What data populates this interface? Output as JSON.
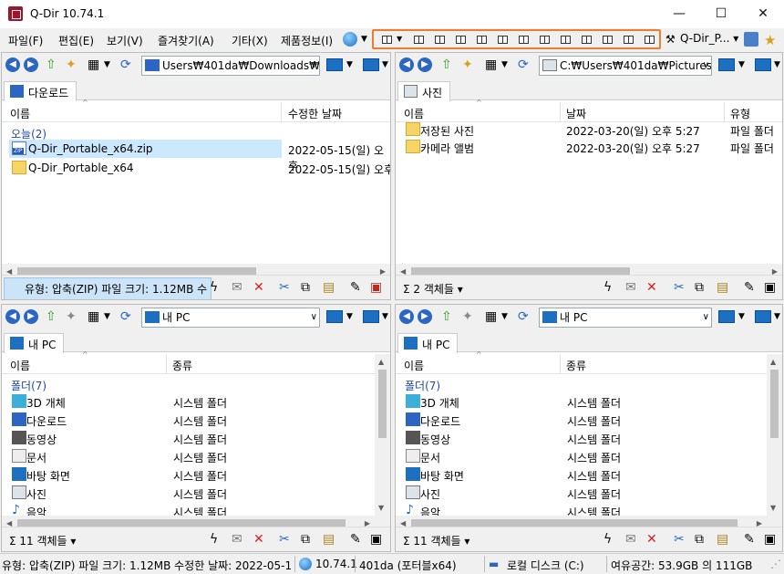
{
  "window": {
    "title": "Q-Dir 10.74.1",
    "min": "—",
    "max": "☐",
    "close": "✕"
  },
  "menu": [
    "파일(F)",
    "편집(E)",
    "보기(V)",
    "즐겨찾기(A)",
    "기타(X)",
    "제품정보(I)"
  ],
  "layout_strip_icons": [
    "layout-4-pane-icon",
    "layout-icon",
    "layout-icon",
    "layout-icon",
    "layout-icon",
    "layout-icon",
    "layout-icon",
    "layout-icon",
    "layout-icon",
    "layout-icon",
    "layout-icon",
    "layout-icon",
    "layout-icon"
  ],
  "qdir_combo": "Q-Dir_P...",
  "panes": {
    "top_left": {
      "address": "Users₩401da₩Downloads₩",
      "tab": "다운로드",
      "columns": [
        "이름",
        "수정한 날짜"
      ],
      "group": "오늘(2)",
      "rows": [
        {
          "name": "Q-Dir_Portable_x64.zip",
          "date": "2022-05-15(일) 오후",
          "icon": "zip-icon",
          "selected": true
        },
        {
          "name": "Q-Dir_Portable_x64",
          "date": "2022-05-15(일) 오후",
          "icon": "folder-icon",
          "selected": false
        }
      ],
      "status": "유형: 압축(ZIP) 파일 크기: 1.12MB 수"
    },
    "top_right": {
      "address": "C:₩Users₩401da₩Pictures₩",
      "tab": "사진",
      "columns": [
        "이름",
        "날짜",
        "유형"
      ],
      "rows": [
        {
          "name": "저장된 사진",
          "date": "2022-03-20(일) 오후 5:27",
          "type": "파일 폴더"
        },
        {
          "name": "카메라 앨범",
          "date": "2022-03-20(일) 오후 5:27",
          "type": "파일 폴더"
        }
      ],
      "status": "Σ  2 객체들 ▾"
    },
    "bottom_left": {
      "address": "내 PC",
      "tab": "내 PC",
      "columns": [
        "이름",
        "종류"
      ],
      "group": "폴더(7)",
      "rows": [
        {
          "name": "3D 개체",
          "type": "시스템 폴더",
          "icon": "cube-3d-icon"
        },
        {
          "name": "다운로드",
          "type": "시스템 폴더",
          "icon": "download-icon"
        },
        {
          "name": "동영상",
          "type": "시스템 폴더",
          "icon": "video-icon"
        },
        {
          "name": "문서",
          "type": "시스템 폴더",
          "icon": "document-icon"
        },
        {
          "name": "바탕 화면",
          "type": "시스템 폴더",
          "icon": "desktop-icon"
        },
        {
          "name": "사진",
          "type": "시스템 폴더",
          "icon": "picture-icon"
        },
        {
          "name": "음악",
          "type": "시스템 폴더",
          "icon": "music-icon"
        }
      ],
      "status": "Σ  11 객체들 ▾"
    },
    "bottom_right": {
      "address": "내 PC",
      "tab": "내 PC",
      "columns": [
        "이름",
        "종류"
      ],
      "group": "폴더(7)",
      "rows": [
        {
          "name": "3D 개체",
          "type": "시스템 폴더",
          "icon": "cube-3d-icon"
        },
        {
          "name": "다운로드",
          "type": "시스템 폴더",
          "icon": "download-icon"
        },
        {
          "name": "동영상",
          "type": "시스템 폴더",
          "icon": "video-icon"
        },
        {
          "name": "문서",
          "type": "시스템 폴더",
          "icon": "document-icon"
        },
        {
          "name": "바탕 화면",
          "type": "시스템 폴더",
          "icon": "desktop-icon"
        },
        {
          "name": "사진",
          "type": "시스템 폴더",
          "icon": "picture-icon"
        },
        {
          "name": "음악",
          "type": "시스템 폴더",
          "icon": "music-icon"
        }
      ],
      "status": "Σ  11 객체들 ▾"
    }
  },
  "bottombar": {
    "info": "유형: 압축(ZIP) 파일 크기: 1.12MB 수정한 날짜: 2022-05-1",
    "version": "10.74.1",
    "user": "401da (포터블x64)",
    "disk": "로컬 디스크 (C:)",
    "free": "여유공간: 53.9GB 의 111GB"
  },
  "colors": {
    "highlight": "#f07b2c",
    "selection": "#cce8ff",
    "group_text": "#1e4a9a"
  }
}
